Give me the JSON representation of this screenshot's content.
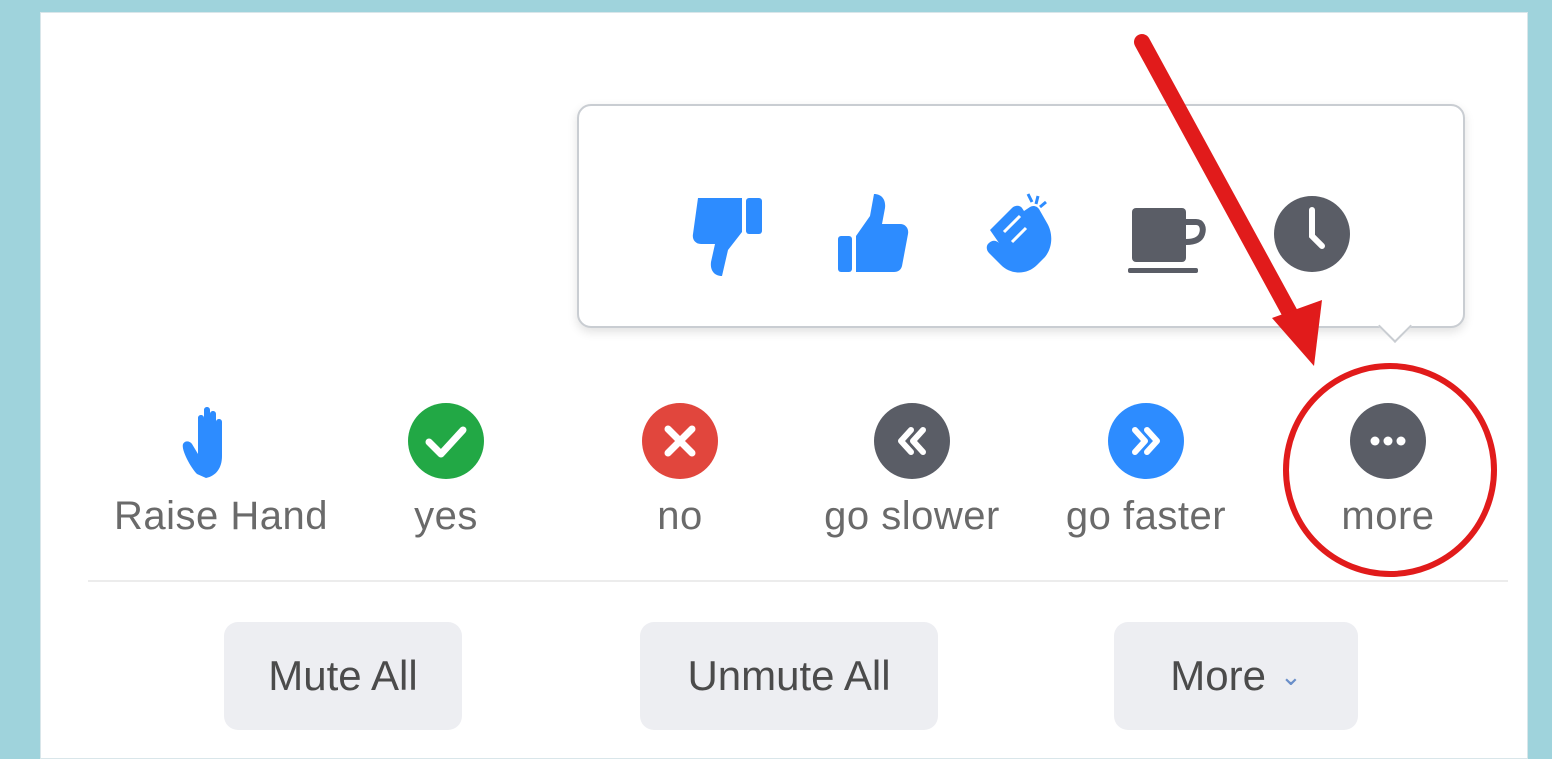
{
  "popup": {
    "emojis": [
      {
        "name": "thumbs-down-icon",
        "color": "#2d8cff"
      },
      {
        "name": "thumbs-up-icon",
        "color": "#2d8cff"
      },
      {
        "name": "clap-icon",
        "color": "#2d8cff"
      },
      {
        "name": "coffee-cup-icon",
        "color": "#5a5d66"
      },
      {
        "name": "clock-icon",
        "color": "#5a5d66"
      }
    ]
  },
  "reactions": [
    {
      "label": "Raise Hand",
      "icon": "raise-hand-icon",
      "color": "#2d8cff"
    },
    {
      "label": "yes",
      "icon": "checkmark-icon",
      "color": "#22a845"
    },
    {
      "label": "no",
      "icon": "x-icon",
      "color": "#e1463d"
    },
    {
      "label": "go slower",
      "icon": "rewind-icon",
      "color": "#5a5d66"
    },
    {
      "label": "go faster",
      "icon": "fast-forward-icon",
      "color": "#2d8cff"
    },
    {
      "label": "more",
      "icon": "ellipsis-icon",
      "color": "#5a5d66"
    }
  ],
  "actions": {
    "mute_all": "Mute All",
    "unmute_all": "Unmute All",
    "more": "More"
  },
  "annotation": {
    "color": "#e11b1b"
  }
}
